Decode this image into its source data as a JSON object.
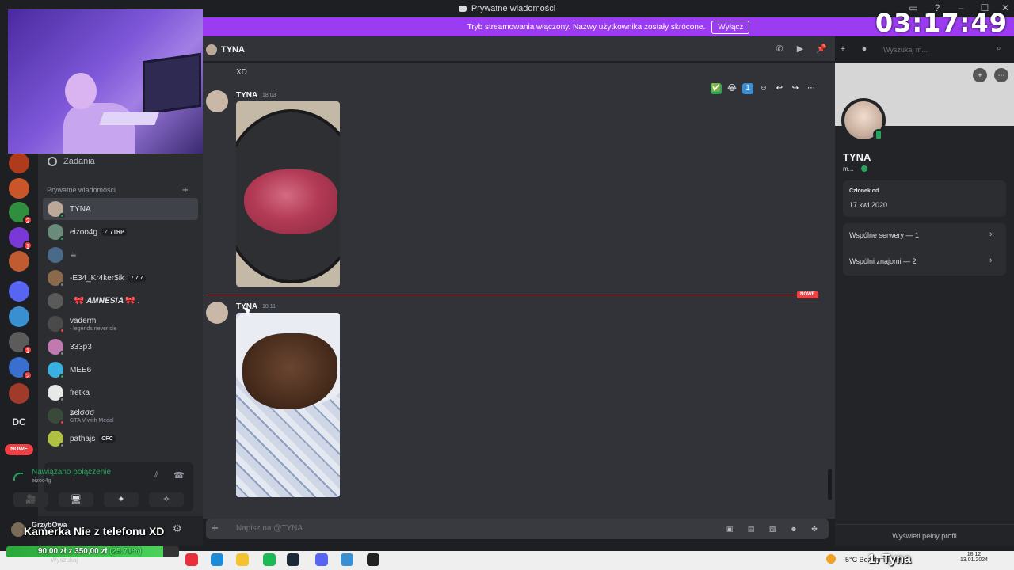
{
  "window": {
    "title": "Prywatne wiadomości",
    "controls": [
      "‒",
      "☐",
      "✕"
    ]
  },
  "stream_banner": {
    "text": "Tryb streamowania włączony. Nazwy użytkownika zostały skrócone.",
    "button": "Wyłącz"
  },
  "overlay": {
    "clock": "03:17:49",
    "camera_caption": "Kamerka Nie z telefonu XD",
    "donation": {
      "raised": "90,00 zł",
      "separator": "z",
      "goal": "350,00 zł",
      "percent": "(25.71%)",
      "progress_fraction": 0.2571
    },
    "now_playing": "1. Tyna"
  },
  "server_rail": {
    "dc_label": "DC",
    "new_label": "NOWE",
    "badges": [
      "2",
      "1",
      "1",
      "2"
    ],
    "colors": [
      "#b03a1c",
      "#c8562a",
      "#2f8f3e",
      "#7a39d6",
      "#c05a30",
      "#5865f2",
      "#3a8fd0",
      "#5b5b5b",
      "#3a6fd0",
      "#a03a2a"
    ]
  },
  "sidebar": {
    "nav": {
      "label": "Zadania",
      "icon": "tasks-icon"
    },
    "dm_header": "Prywatne wiadomości",
    "dms": [
      {
        "name": "TYNA",
        "sub": "",
        "tag": "",
        "avatar_color": "#bca898",
        "status": "#23a55a",
        "active": true
      },
      {
        "name": "eizoo4g",
        "sub": "",
        "tag": "✓ 7TRP",
        "avatar_color": "#6a8a7a",
        "status": "#23a55a",
        "active": false
      },
      {
        "name": "☕",
        "sub": "",
        "tag": "",
        "avatar_color": "#4a6a8a",
        "status": "",
        "active": false
      },
      {
        "name": "-E34_Kr4ker$ik",
        "sub": "",
        "tag": "7 7 7",
        "avatar_color": "#8a6a4a",
        "status": "#80848e",
        "active": false
      },
      {
        "name": ". 🎀 𝑨𝑴𝑵𝑬𝑺𝑰𝑨 🎀 .",
        "sub": "",
        "tag": "",
        "avatar_color": "#5a5a5a",
        "status": "",
        "active": false
      },
      {
        "name": "vaderm",
        "sub": "- legends never die",
        "tag": "",
        "avatar_color": "#4a4a4a",
        "status": "#f23f43",
        "active": false
      },
      {
        "name": "333p3",
        "sub": "",
        "tag": "",
        "avatar_color": "#c07ab0",
        "status": "#80848e",
        "active": false
      },
      {
        "name": "MEE6",
        "sub": "",
        "tag": "",
        "avatar_color": "#3ab0e0",
        "status": "#23a55a",
        "active": false
      },
      {
        "name": "fretka",
        "sub": "",
        "tag": "",
        "avatar_color": "#e8e8e8",
        "status": "#80848e",
        "active": false
      },
      {
        "name": "ʑєłσσσ",
        "sub": "GTA V with Medal",
        "tag": "",
        "avatar_color": "#3a4a3a",
        "status": "#f23f43",
        "active": false
      },
      {
        "name": "pathajs",
        "sub": "",
        "tag": "CFC",
        "avatar_color": "#b0c040",
        "status": "#80848e",
        "active": false
      }
    ]
  },
  "voice": {
    "status": "Nawiązano połączenie",
    "user": "eizoo4g",
    "buttons": [
      "🎥",
      "🖥",
      "✦",
      "✧"
    ]
  },
  "user_panel": {
    "name": "GrzybOwa",
    "search_label": "Wyszukaj"
  },
  "chat": {
    "title": "TYNA",
    "search_placeholder": "Wyszukaj m...",
    "header_icons": [
      "phone-icon",
      "video-icon",
      "pin-icon",
      "add-friend-icon",
      "profile-icon"
    ],
    "messages": [
      {
        "author": "TYNA",
        "time": "18:03",
        "kind": "photo-raw-steak"
      },
      {
        "author": "TYNA",
        "time": "18:11",
        "kind": "photo-cooked-steak"
      }
    ],
    "previous_text": "XD",
    "new_marker": "NOWE",
    "hover_tools": [
      "✅",
      "😂",
      "1",
      "☺",
      "↩",
      "↪",
      "⋯"
    ],
    "composer_placeholder": "Napisz na @TYNA",
    "composer_icons": [
      "gift-icon",
      "gif-icon",
      "sticker-icon",
      "emoji-icon",
      "apps-icon"
    ]
  },
  "profile": {
    "name": "TYNA",
    "sub": "m...",
    "member_label": "Członek od",
    "member_date": "17 kwi 2020",
    "mutual_servers": "Wspólne serwery — 1",
    "mutual_friends": "Wspólni znajomi — 2",
    "full_profile": "Wyświetl pełny profil"
  },
  "taskbar": {
    "apps": [
      {
        "name": "opera-icon",
        "color": "#e8303a"
      },
      {
        "name": "edge-icon",
        "color": "#1f8ad6"
      },
      {
        "name": "explorer-icon",
        "color": "#f2c230"
      },
      {
        "name": "spotify-icon",
        "color": "#1db954"
      },
      {
        "name": "steam-icon",
        "color": "#1b2838"
      },
      {
        "name": "discord-icon",
        "color": "#5865f2"
      },
      {
        "name": "app-icon",
        "color": "#3a8fd0"
      },
      {
        "name": "obs-icon",
        "color": "#222222"
      }
    ],
    "weather": "-5°C  Bezchmurnie",
    "time": "18:12",
    "date": "13.01.2024"
  }
}
